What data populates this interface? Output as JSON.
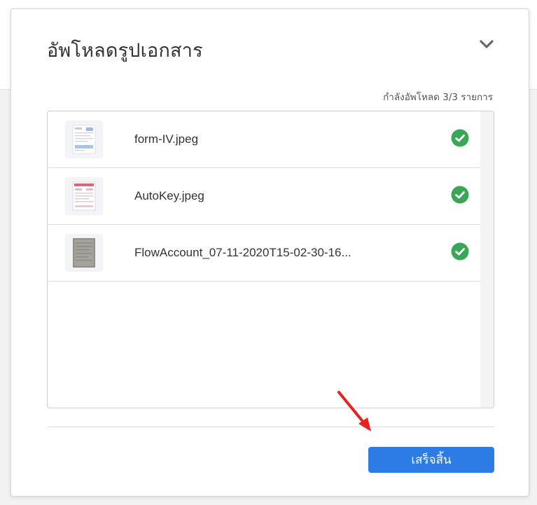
{
  "modal": {
    "title": "อัพโหลดรูปเอกสาร",
    "status": "กำลังอัพโหลด 3/3 รายการ",
    "collapse_icon": "chevron-down-icon",
    "files": [
      {
        "name": "form-IV.jpeg",
        "status_icon": "check-circle-icon",
        "status": "uploaded"
      },
      {
        "name": "AutoKey.jpeg",
        "status_icon": "check-circle-icon",
        "status": "uploaded"
      },
      {
        "name": "FlowAccount_07-11-2020T15-02-30-16...",
        "status_icon": "check-circle-icon",
        "status": "uploaded"
      }
    ],
    "finish_label": "เสร็จสิ้น"
  },
  "colors": {
    "accent": "#2d7be5",
    "success": "#3aa757",
    "annotation": "#e82020"
  }
}
